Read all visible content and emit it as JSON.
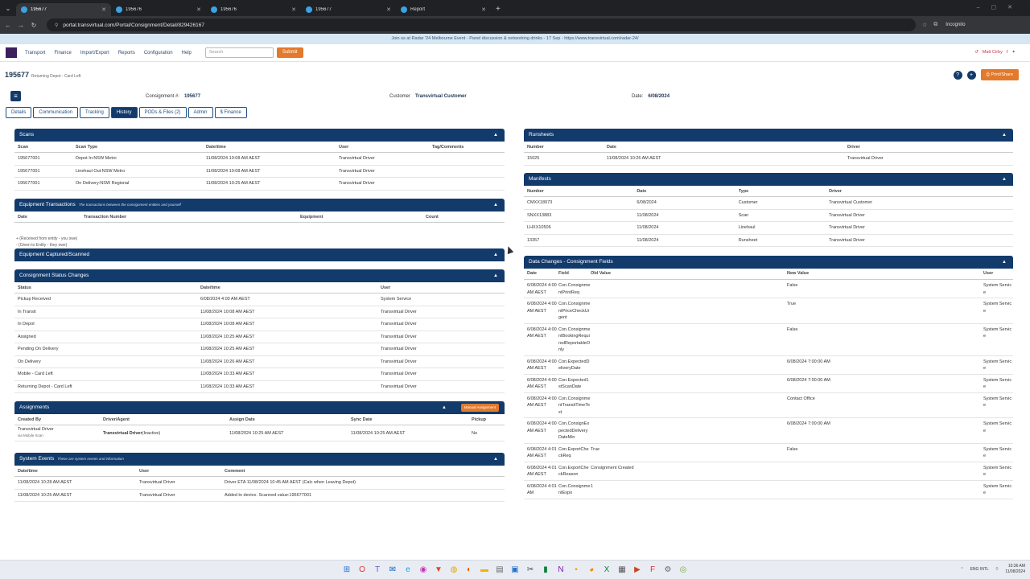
{
  "browser": {
    "tabs": [
      {
        "title": "195677",
        "active": true
      },
      {
        "title": "195676",
        "active": false
      },
      {
        "title": "195676",
        "active": false
      },
      {
        "title": "195677",
        "active": false
      },
      {
        "title": "Report",
        "active": false
      }
    ],
    "url": "portal.transvirtual.com/Portal/Consignment/Detail/829426167",
    "incognito": "Incognito"
  },
  "banner": "Join us at Radar '24 Melbourne Event - Panel discussion & networking drinks - 17 Sep - https://www.transvirtual.com/radar-24/",
  "topnav": {
    "items": [
      "Transport",
      "Finance",
      "Import/Export",
      "Reports",
      "Configuration",
      "Help"
    ],
    "search_placeholder": "Search",
    "submit": "Submit",
    "user": "Matt Cirby"
  },
  "header": {
    "id": "195677",
    "subtitle": "Returning Depot - Card Left",
    "consignment_label": "Consignment #:",
    "consignment_value": "195677",
    "customer_label": "Customer",
    "customer_value": "Transvirtual Customer",
    "date_label": "Date:",
    "date_value": "6/08/2024",
    "print": "Print/Share"
  },
  "tabs": [
    "Details",
    "Communication",
    "Tracking",
    "History",
    "PODs & Files (2)",
    "Admin",
    "$ Finance"
  ],
  "scans": {
    "title": "Scans",
    "headers": [
      "Scan",
      "Scan Type",
      "Date/time",
      "User",
      "Tag/Comments"
    ],
    "rows": [
      [
        "195677001",
        "Depot In:NSW Metro",
        "11/08/2024 10:08 AM AEST",
        "Transvirtual Driver",
        ""
      ],
      [
        "195677001",
        "Linehaul Out:NSW Metro",
        "11/08/2024 10:08 AM AEST",
        "Transvirtual Driver",
        ""
      ],
      [
        "195677001",
        "On Delivery:NSW Regional",
        "11/08/2024 10:25 AM AEST",
        "Transvirtual Driver",
        ""
      ]
    ]
  },
  "equipment_tx": {
    "title": "Equipment Transactions",
    "subtitle": "The transactions between the consignment entities and yourself",
    "headers": [
      "Date",
      "Transaction Number",
      "Equipment",
      "Count"
    ],
    "notes": [
      "+ (Received from entity - you owe)",
      "- (Given to Entity - they owe)"
    ]
  },
  "equipment_captured": {
    "title": "Equipment Captured/Scanned"
  },
  "status_changes": {
    "title": "Consignment Status Changes",
    "headers": [
      "Status",
      "Date/time",
      "User"
    ],
    "rows": [
      [
        "Pickup Received",
        "6/08/2024 4:00 AM AEST",
        "System Service"
      ],
      [
        "In Transit",
        "11/08/2024 10:08 AM AEST",
        "Transvirtual Driver"
      ],
      [
        "In Depot",
        "11/08/2024 10:08 AM AEST",
        "Transvirtual Driver"
      ],
      [
        "Assigned",
        "11/08/2024 10:25 AM AEST",
        "Transvirtual Driver"
      ],
      [
        "Pending On Delivery",
        "11/08/2024 10:25 AM AEST",
        "Transvirtual Driver"
      ],
      [
        "On Delivery",
        "11/08/2024 10:26 AM AEST",
        "Transvirtual Driver"
      ],
      [
        "Mobile - Card Left",
        "11/08/2024 10:33 AM AEST",
        "Transvirtual Driver"
      ],
      [
        "Returning Depot - Card Left",
        "11/08/2024 10:33 AM AEST",
        "Transvirtual Driver"
      ]
    ]
  },
  "assignments": {
    "title": "Assignments",
    "manual": "Manual Assignment",
    "headers": [
      "Created By",
      "Driver/Agent",
      "Assign Date",
      "Sync Date",
      "Pickup"
    ],
    "row": {
      "created_by": "Transvirtual Driver",
      "via": "via Mobile Scan",
      "driver": "Transvirtual Driver",
      "inactive": "(Inactive)",
      "assign": "11/08/2024 10:25 AM AEST",
      "sync": "11/08/2024 10:25 AM AEST",
      "pickup": "No"
    }
  },
  "system_events": {
    "title": "System Events",
    "subtitle": "These are system events and information",
    "headers": [
      "Date/time",
      "User",
      "Comment"
    ],
    "rows": [
      [
        "11/08/2024 10:28 AM AEST",
        "Transvirtual Driver",
        "Driver ETA 11/08/2024 10:45 AM AEST (Calc when Leaving Depot)"
      ],
      [
        "11/08/2024 10:25 AM AEST",
        "Transvirtual Driver",
        "Added to device. Scanned value:195677001"
      ]
    ]
  },
  "runsheets": {
    "title": "Runsheets",
    "headers": [
      "Number",
      "Date",
      "Driver"
    ],
    "rows": [
      [
        "15025",
        "11/08/2024 10:26 AM AEST",
        "Transvirtual Driver"
      ]
    ]
  },
  "manifests": {
    "title": "Manifests",
    "headers": [
      "Number",
      "Date",
      "Type",
      "Driver"
    ],
    "rows": [
      [
        "CMXX18973",
        "6/08/2024",
        "Customer",
        "Transvirtual Customer"
      ],
      [
        "SNXX13883",
        "11/08/2024",
        "Scan",
        "Transvirtual Driver"
      ],
      [
        "LHXX10506",
        "11/08/2024",
        "Linehaul",
        "Transvirtual Driver"
      ],
      [
        "13357",
        "11/08/2024",
        "Runsheet",
        "Transvirtual Driver"
      ]
    ]
  },
  "data_changes": {
    "title": "Data Changes - Consignment Fields",
    "headers": [
      "Date",
      "Field",
      "Old Value",
      "New Value",
      "User"
    ],
    "rows": [
      [
        "6/08/2024 4:00 AM AEST",
        "Con.ConsignmentPrintReq",
        "",
        "False",
        "System Service"
      ],
      [
        "6/08/2024 4:00 AM AEST",
        "Con.ConsignmentPriceCheckUrgent",
        "",
        "True",
        "System Service"
      ],
      [
        "6/08/2024 4:00 AM AEST",
        "Con.ConsignmentBookingRequiredReportableOnly",
        "",
        "False",
        "System Service"
      ],
      [
        "6/08/2024 4:00 AM AEST",
        "Con.ExpectedDeliveryDate",
        "",
        "6/08/2024 7:00:00 AM",
        "System Service"
      ],
      [
        "6/08/2024 4:00 AM AEST",
        "Con.Expected1stScanDate",
        "",
        "6/08/2024 7:00:00 AM",
        "System Service"
      ],
      [
        "6/08/2024 4:00 AM AEST",
        "Con.ConsignmentTransitTimeText",
        "",
        "Contact Office",
        "System Service"
      ],
      [
        "6/08/2024 4:00 AM AEST",
        "Con.ConsignExpectedDeliveryDateMin",
        "",
        "6/08/2024 7:00:00 AM",
        "System Service"
      ],
      [
        "6/08/2024 4:01 AM AEST",
        "Con.ExportCheckReq",
        "True",
        "False",
        "System Service"
      ],
      [
        "6/08/2024 4:01 AM AEST",
        "Con.ExportCheckReason",
        "Consignment Created",
        "",
        "System Service"
      ],
      [
        "6/08/2024 4:01 AM",
        "Con.ConsignmentExpo",
        "1",
        "",
        "System Service"
      ]
    ]
  },
  "clock": {
    "lang": "ENG INTL",
    "time": "10:36 AM",
    "date": "11/08/2024"
  }
}
